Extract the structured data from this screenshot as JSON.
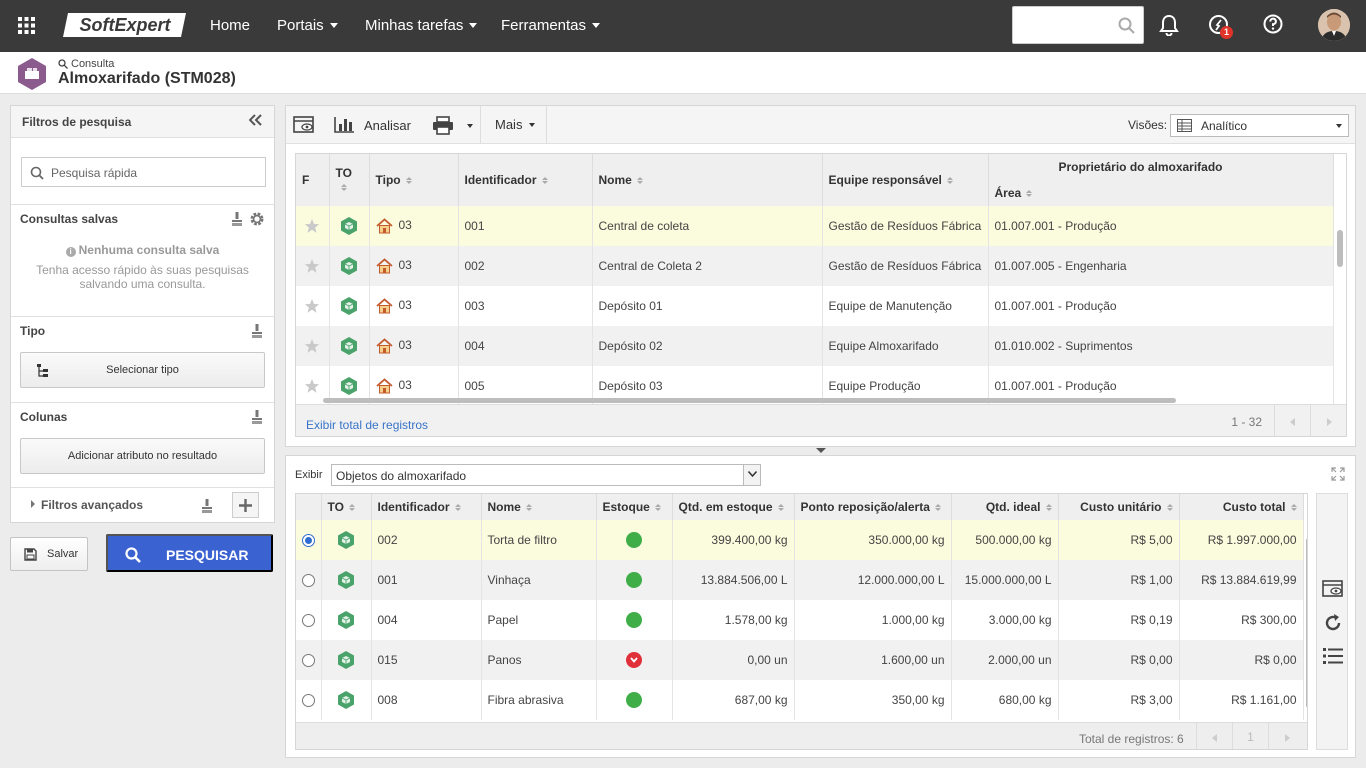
{
  "topbar": {
    "logo_text": "SoftExpert",
    "nav": [
      {
        "label": "Home",
        "has_menu": false
      },
      {
        "label": "Portais",
        "has_menu": true
      },
      {
        "label": "Minhas tarefas",
        "has_menu": true
      },
      {
        "label": "Ferramentas",
        "has_menu": true
      }
    ],
    "notification_count": "1"
  },
  "header": {
    "breadcrumb": "Consulta",
    "title": "Almoxarifado (STM028)"
  },
  "filters": {
    "title": "Filtros de pesquisa",
    "quick_search_placeholder": "Pesquisa rápida",
    "saved_title": "Consultas salvas",
    "saved_empty_title": "Nenhuma consulta salva",
    "saved_empty_text_1": "Tenha acesso rápido às suas pesquisas",
    "saved_empty_text_2": "salvando uma consulta.",
    "tipo_title": "Tipo",
    "tipo_button": "Selecionar tipo",
    "colunas_title": "Colunas",
    "colunas_button": "Adicionar atributo no resultado",
    "advanced": "Filtros avançados",
    "save_button": "Salvar",
    "search_button": "PESQUISAR"
  },
  "toolbar": {
    "analisar": "Analisar",
    "mais": "Mais",
    "visoes_label": "Visões:",
    "visoes_value": "Analítico"
  },
  "grid1": {
    "group_header": "Proprietário do almoxarifado",
    "columns": [
      "F",
      "TO",
      "Tipo",
      "Identificador",
      "Nome",
      "Equipe responsável",
      "Área"
    ],
    "rows": [
      {
        "tipo": "03",
        "id": "001",
        "nome": "Central de coleta",
        "equipe": "Gestão de Resíduos Fábrica",
        "area": "01.007.001 - Produção"
      },
      {
        "tipo": "03",
        "id": "002",
        "nome": "Central de Coleta 2",
        "equipe": "Gestão de Resíduos Fábrica",
        "area": "01.007.005 - Engenharia"
      },
      {
        "tipo": "03",
        "id": "003",
        "nome": "Depósito 01",
        "equipe": "Equipe de Manutenção",
        "area": "01.007.001 - Produção"
      },
      {
        "tipo": "03",
        "id": "004",
        "nome": "Depósito 02",
        "equipe": "Equipe Almoxarifado",
        "area": "01.010.002 - Suprimentos"
      },
      {
        "tipo": "03",
        "id": "005",
        "nome": "Depósito 03",
        "equipe": "Equipe Produção",
        "area": "01.007.001 - Produção"
      }
    ],
    "footer_link": "Exibir total de registros",
    "page_range": "1 - 32"
  },
  "detail": {
    "exibir_label": "Exibir",
    "exibir_value": "Objetos do almoxarifado",
    "columns": [
      "TO",
      "Identificador",
      "Nome",
      "Estoque",
      "Qtd. em estoque",
      "Ponto reposição/alerta",
      "Qtd. ideal",
      "Custo unitário",
      "Custo total"
    ],
    "rows": [
      {
        "selected": true,
        "id": "002",
        "nome": "Torta de filtro",
        "estoque": "ok",
        "qtd": "399.400,00 kg",
        "ponto": "350.000,00 kg",
        "ideal": "500.000,00 kg",
        "unit": "R$ 5,00",
        "total": "R$ 1.997.000,00"
      },
      {
        "selected": false,
        "id": "001",
        "nome": "Vinhaça",
        "estoque": "ok",
        "qtd": "13.884.506,00 L",
        "ponto": "12.000.000,00 L",
        "ideal": "15.000.000,00 L",
        "unit": "R$ 1,00",
        "total": "R$ 13.884.619,99"
      },
      {
        "selected": false,
        "id": "004",
        "nome": "Papel",
        "estoque": "ok",
        "qtd": "1.578,00 kg",
        "ponto": "1.000,00 kg",
        "ideal": "3.000,00 kg",
        "unit": "R$ 0,19",
        "total": "R$ 300,00"
      },
      {
        "selected": false,
        "id": "015",
        "nome": "Panos",
        "estoque": "low",
        "qtd": "0,00 un",
        "ponto": "1.600,00 un",
        "ideal": "2.000,00 un",
        "unit": "R$ 0,00",
        "total": "R$ 0,00"
      },
      {
        "selected": false,
        "id": "008",
        "nome": "Fibra abrasiva",
        "estoque": "ok",
        "qtd": "687,00 kg",
        "ponto": "350,00 kg",
        "ideal": "680,00 kg",
        "unit": "R$ 3,00",
        "total": "R$ 1.161,00"
      }
    ],
    "total_label": "Total de registros: 6",
    "page": "1"
  },
  "colors": {
    "topbar": "#3a3a3a",
    "accent": "#3a62d1",
    "highlight_row": "#fbfbdd",
    "ok": "#3fae49",
    "alert": "#e0303a"
  }
}
